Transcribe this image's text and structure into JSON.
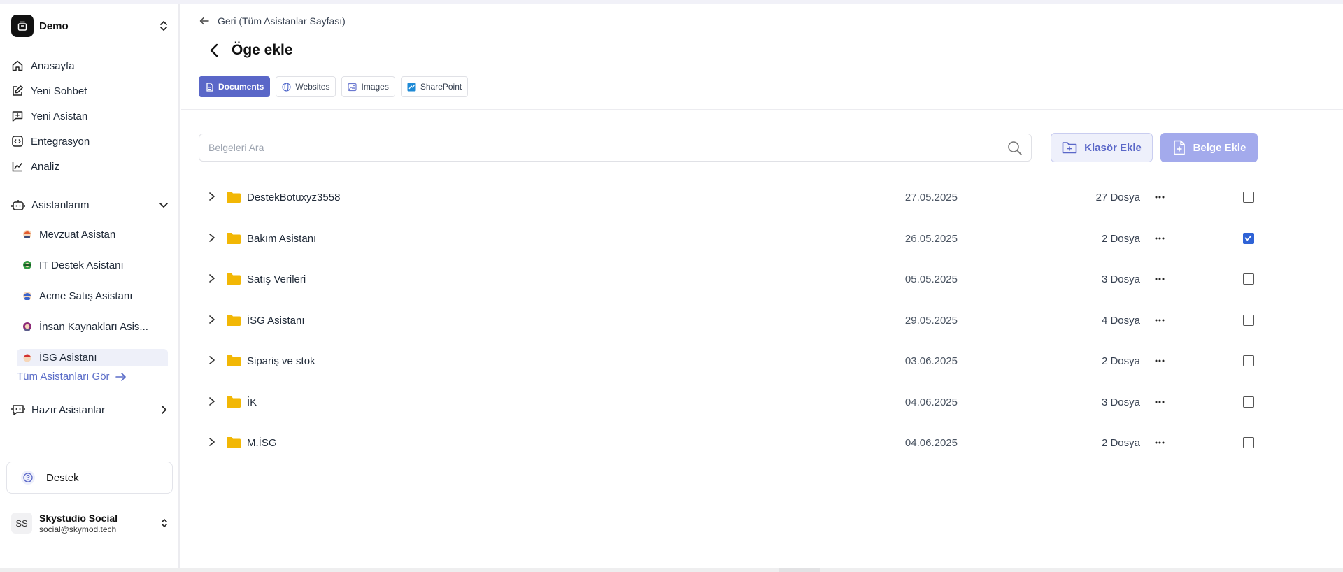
{
  "workspace": {
    "name": "Demo"
  },
  "nav": [
    {
      "label": "Anasayfa",
      "icon": "home-icon"
    },
    {
      "label": "Yeni Sohbet",
      "icon": "edit-icon"
    },
    {
      "label": "Yeni Asistan",
      "icon": "message-plus-icon"
    },
    {
      "label": "Entegrasyon",
      "icon": "code-icon"
    },
    {
      "label": "Analiz",
      "icon": "chart-line-icon"
    }
  ],
  "assistants_section": {
    "label": "Asistanlarım",
    "items": [
      {
        "label": "Mevzuat Asistan",
        "color": "#e35b2f"
      },
      {
        "label": "IT Destek Asistanı",
        "color": "#2e9a3e"
      },
      {
        "label": "Acme Satış Asistanı",
        "color": "#3a63c9"
      },
      {
        "label": "İnsan Kaynakları Asis...",
        "color": "#8c2a77"
      },
      {
        "label": "İSG Asistanı",
        "color": "#d23232"
      }
    ],
    "see_all": "Tüm Asistanları Gör"
  },
  "ready_section": {
    "label": "Hazır Asistanlar"
  },
  "support": {
    "label": "Destek"
  },
  "user": {
    "initials": "SS",
    "name": "Skystudio Social",
    "email": "social@skymod.tech"
  },
  "main": {
    "back_label": "Geri (Tüm Asistanlar Sayfası)",
    "title": "Öge ekle",
    "tabs": [
      {
        "label": "Documents",
        "icon": "document-icon",
        "active": true
      },
      {
        "label": "Websites",
        "icon": "globe-icon",
        "active": false
      },
      {
        "label": "Images",
        "icon": "image-icon",
        "active": false
      },
      {
        "label": "SharePoint",
        "icon": "sharepoint-icon",
        "active": false
      }
    ],
    "search": {
      "placeholder": "Belgeleri Ara",
      "value": ""
    },
    "add_folder_label": "Klasör Ekle",
    "add_document_label": "Belge Ekle",
    "rows": [
      {
        "name": "DestekBotuxyz3558",
        "date": "27.05.2025",
        "count": "27 Dosya",
        "checked": false
      },
      {
        "name": "Bakım Asistanı",
        "date": "26.05.2025",
        "count": "2 Dosya",
        "checked": true
      },
      {
        "name": "Satış Verileri",
        "date": "05.05.2025",
        "count": "3 Dosya",
        "checked": false
      },
      {
        "name": "İSG Asistanı",
        "date": "29.05.2025",
        "count": "4 Dosya",
        "checked": false
      },
      {
        "name": "Sipariş ve stok",
        "date": "03.06.2025",
        "count": "2 Dosya",
        "checked": false
      },
      {
        "name": "İK",
        "date": "04.06.2025",
        "count": "3 Dosya",
        "checked": false
      },
      {
        "name": "M.İSG",
        "date": "04.06.2025",
        "count": "2 Dosya",
        "checked": false
      }
    ]
  },
  "colors": {
    "accent": "#5a67c8",
    "accent_light": "#a3aaec",
    "folder": "#f2b705",
    "checkbox": "#2f63d6"
  }
}
